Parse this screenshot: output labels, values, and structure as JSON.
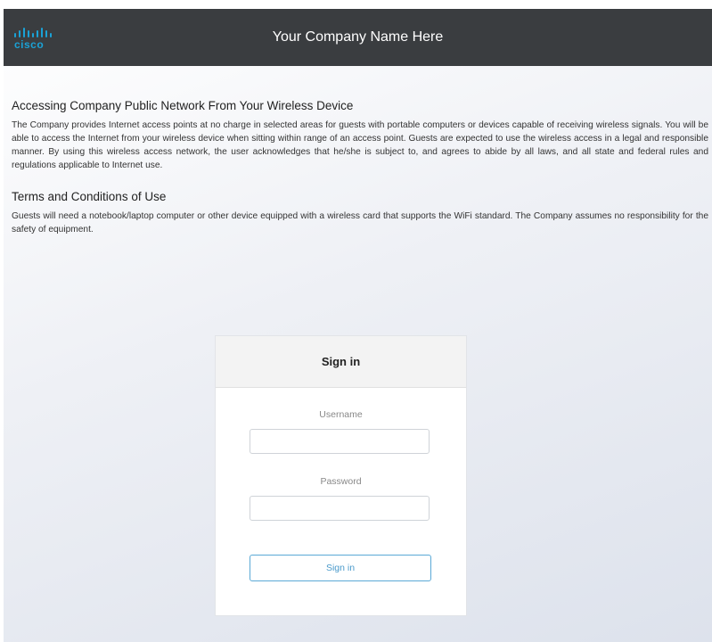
{
  "header": {
    "logo_text": "cisco",
    "company_name": "Your Company Name Here"
  },
  "sections": [
    {
      "title": "Accessing Company Public Network From Your Wireless Device",
      "body": "The Company provides Internet access points at no charge in selected areas for guests with portable computers or devices capable of receiving wireless signals. You will be able to access the Internet from your wireless device when sitting within range of an access point. Guests are expected to use the wireless access in a legal and responsible manner. By using this wireless access network, the user acknowledges that he/she is subject to, and agrees to abide by all laws, and all state and federal rules and regulations applicable to Internet use."
    },
    {
      "title": "Terms and Conditions of Use",
      "body": "Guests will need a notebook/laptop computer or other device equipped with a wireless card that supports the WiFi standard. The Company assumes no responsibility for the safety of equipment."
    }
  ],
  "signin_form": {
    "title": "Sign in",
    "username_label": "Username",
    "username_value": "",
    "password_label": "Password",
    "password_value": "",
    "submit_label": "Sign in"
  },
  "colors": {
    "header_bg": "#3a3d40",
    "logo": "#1aa2d6",
    "button_border": "#5aa9d6"
  }
}
